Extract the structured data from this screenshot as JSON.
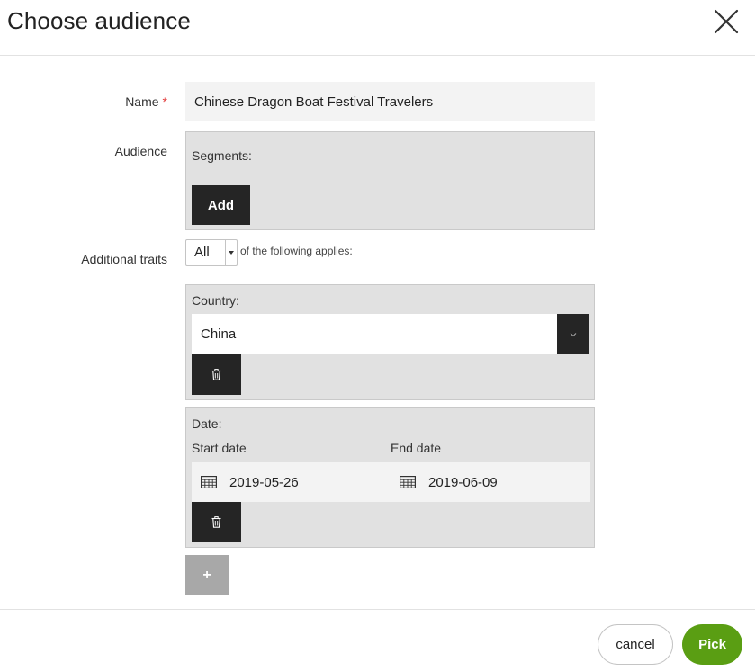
{
  "dialog": {
    "title": "Choose audience",
    "close_icon": "close-icon"
  },
  "form": {
    "name_label": "Name",
    "required_mark": "*",
    "name_value": "Chinese Dragon Boat Festival Travelers",
    "audience_label": "Audience",
    "segments_label": "Segments:",
    "add_label": "Add",
    "additional_traits_label": "Additional traits",
    "traits_operator": "All",
    "traits_suffix": "of the following applies:"
  },
  "traits": {
    "country": {
      "label": "Country:",
      "value": "China",
      "delete_icon": "trash-icon"
    },
    "date": {
      "label": "Date:",
      "start_label": "Start date",
      "end_label": "End date",
      "start_value": "2019-05-26",
      "end_value": "2019-06-09",
      "calendar_icon": "calendar-icon",
      "delete_icon": "trash-icon"
    },
    "add_trait_label": "+"
  },
  "footer": {
    "cancel_label": "cancel",
    "pick_label": "Pick"
  },
  "colors": {
    "accent": "#5a9e13",
    "dark_button": "#252525",
    "required": "#e23b3b"
  }
}
